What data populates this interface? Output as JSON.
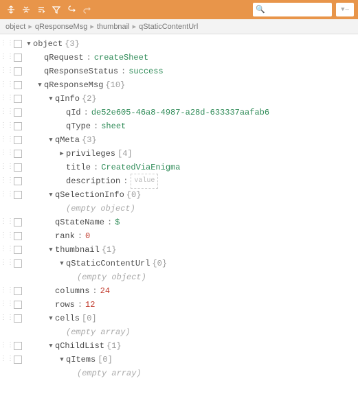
{
  "toolbar": {
    "search_placeholder": ""
  },
  "breadcrumb": [
    "object",
    "qResponseMsg",
    "thumbnail",
    "qStaticContentUrl"
  ],
  "labels": {
    "root": "object",
    "empty_value_box": "value",
    "empty_object": "(empty object)",
    "empty_array": "(empty array)"
  },
  "tree": {
    "root_count": "{3}",
    "items": [
      {
        "key": "qRequest",
        "sep": ":",
        "val": "createSheet",
        "type": "str"
      },
      {
        "key": "qResponseStatus",
        "sep": ":",
        "val": "success",
        "type": "str"
      },
      {
        "key": "qResponseMsg",
        "count": "{10}",
        "children": [
          {
            "key": "qInfo",
            "count": "{2}",
            "children": [
              {
                "key": "qId",
                "sep": ":",
                "val": "de52e605-46a8-4987-a28d-633337aafab6",
                "type": "str"
              },
              {
                "key": "qType",
                "sep": ":",
                "val": "sheet",
                "type": "str"
              }
            ]
          },
          {
            "key": "qMeta",
            "count": "{3}",
            "children": [
              {
                "key": "privileges",
                "count": "[4]",
                "collapsed": true
              },
              {
                "key": "title",
                "sep": ":",
                "val": "CreatedViaEnigma",
                "type": "str"
              },
              {
                "key": "description",
                "sep": ":",
                "val": "",
                "type": "emptybox"
              }
            ]
          },
          {
            "key": "qSelectionInfo",
            "count": "{0}",
            "children": [
              {
                "type": "empty_object"
              }
            ]
          },
          {
            "key": "qStateName",
            "sep": ":",
            "val": "$",
            "type": "str"
          },
          {
            "key": "rank",
            "sep": ":",
            "val": "0",
            "type": "num"
          },
          {
            "key": "thumbnail",
            "count": "{1}",
            "children": [
              {
                "key": "qStaticContentUrl",
                "count": "{0}",
                "children": [
                  {
                    "type": "empty_object"
                  }
                ]
              }
            ]
          },
          {
            "key": "columns",
            "sep": ":",
            "val": "24",
            "type": "num"
          },
          {
            "key": "rows",
            "sep": ":",
            "val": "12",
            "type": "num"
          },
          {
            "key": "cells",
            "count": "[0]",
            "children": [
              {
                "type": "empty_array"
              }
            ]
          },
          {
            "key": "qChildList",
            "count": "{1}",
            "children": [
              {
                "key": "qItems",
                "count": "[0]",
                "children": [
                  {
                    "type": "empty_array"
                  }
                ]
              }
            ]
          }
        ]
      }
    ]
  },
  "chart_data": null
}
